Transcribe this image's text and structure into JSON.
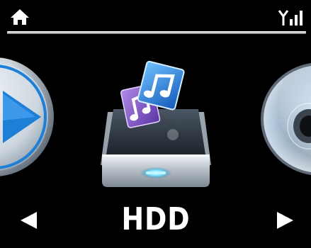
{
  "status_bar": {
    "home_icon": "home-icon",
    "signal_icon": "signal-strength-icon",
    "accent_color": "#ffffff"
  },
  "carousel": {
    "previous_item": {
      "icon": "play-button-icon"
    },
    "current_item": {
      "icon": "hard-drive-music-icon",
      "label": "HDD"
    },
    "next_item": {
      "icon": "disc-icon"
    }
  },
  "navigation": {
    "prev_icon": "left-arrow-icon",
    "next_icon": "right-arrow-icon"
  },
  "colors": {
    "background": "#000000",
    "play_blue": "#1e7fd6",
    "note_blue": "#2a8ee6",
    "note_purple": "#8a5ad0",
    "drive_silver": "#b8bfc6",
    "drive_glow": "#6fe0ff"
  }
}
